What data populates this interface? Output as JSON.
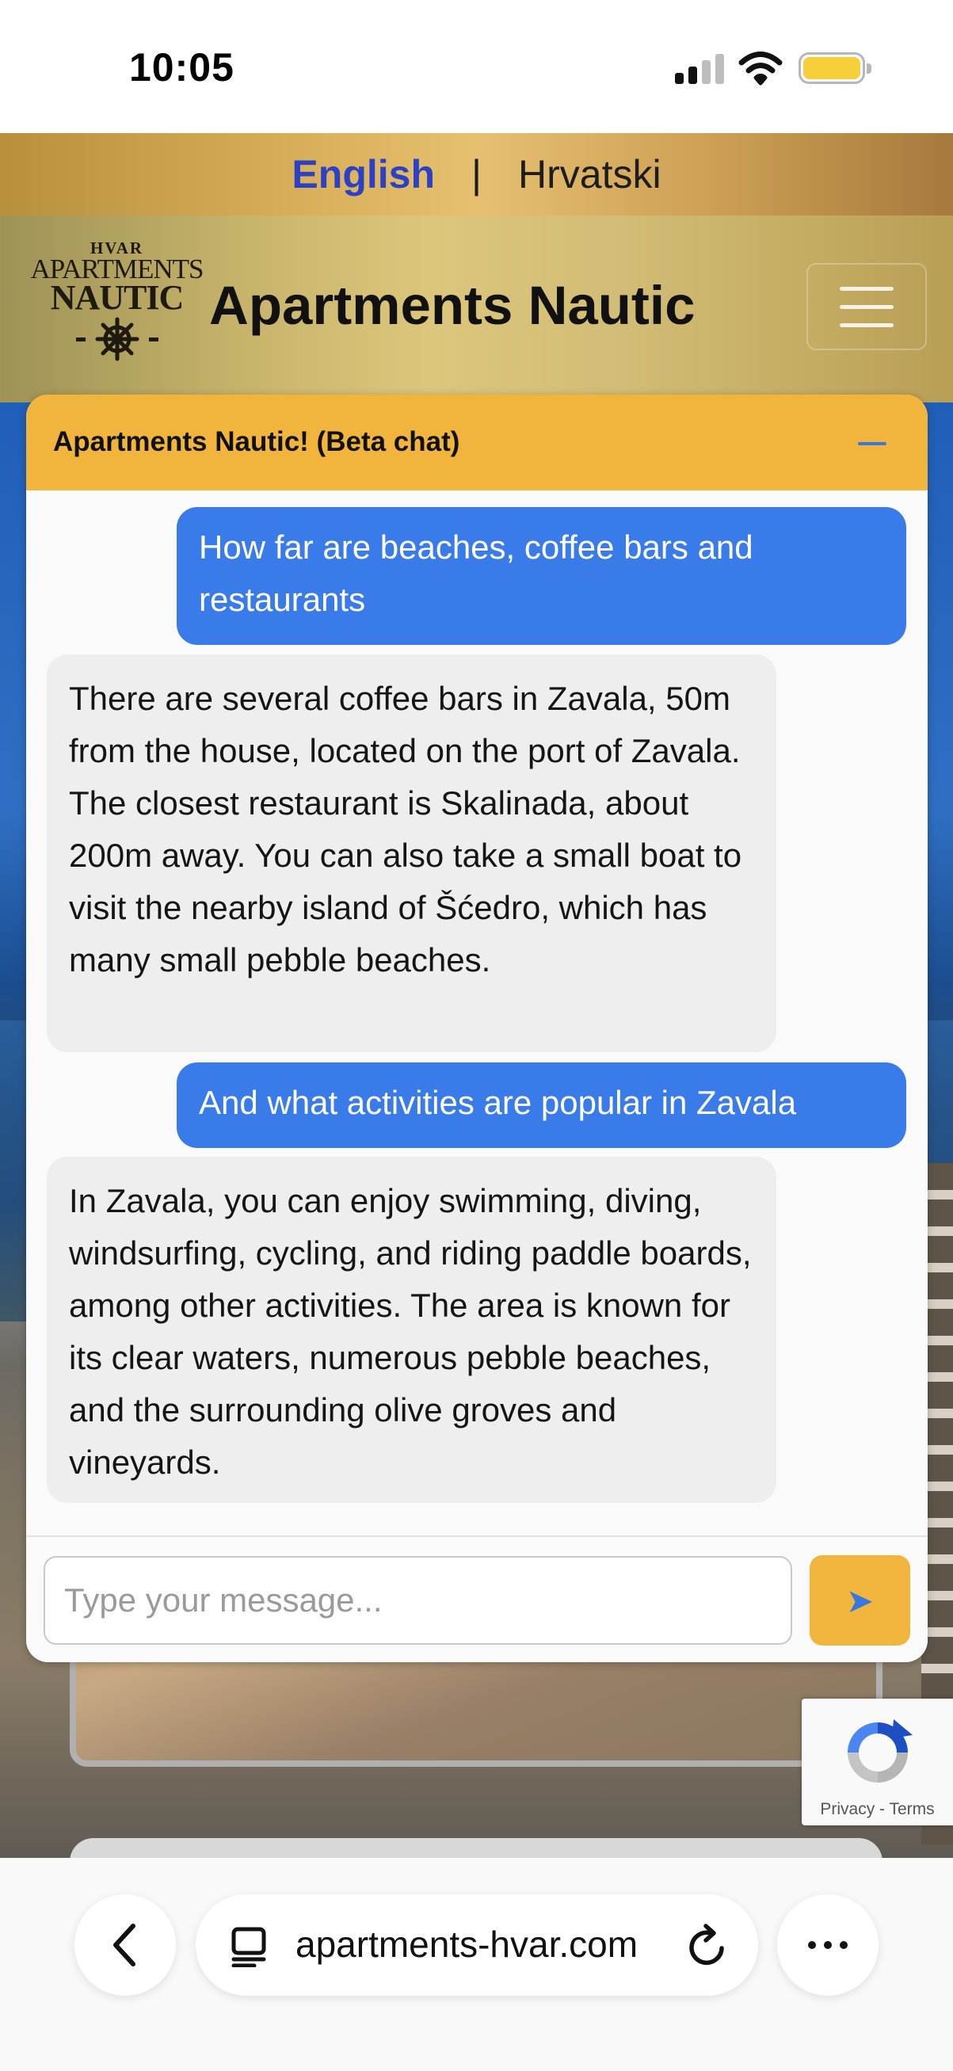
{
  "status_bar": {
    "time": "10:05"
  },
  "language_bar": {
    "english": "English",
    "separator": "|",
    "croatian": "Hrvatski"
  },
  "header": {
    "logo": {
      "line1": "HVAR",
      "line2": "APARTMENTS",
      "line3": "NAUTIC"
    },
    "title": "Apartments Nautic"
  },
  "chat": {
    "title": "Apartments Nautic! (Beta chat)",
    "messages": [
      {
        "role": "user",
        "text": "How far are beaches, coffee bars and restaurants"
      },
      {
        "role": "bot",
        "text": "There are several coffee bars in Zavala, 50m from the house, located on the port of Zavala. The closest restaurant is Skalinada, about 200m away. You can also take a small boat to visit the nearby island of Šćedro, which has many small pebble beaches."
      },
      {
        "role": "user",
        "text": "And what activities are popular in Zavala"
      },
      {
        "role": "bot",
        "text": "In Zavala, you can enjoy swimming, diving, windsurfing, cycling, and riding paddle boards, among other activities. The area is known for its clear waters, numerous pebble beaches, and the surrounding olive groves and vineyards."
      }
    ],
    "input_placeholder": "Type your message...",
    "send_icon": "➤"
  },
  "recaptcha": {
    "links": "Privacy - Terms"
  },
  "browser": {
    "url": "apartments-hvar.com"
  },
  "colors": {
    "user_bubble": "#3a7bea",
    "bot_bubble": "#eeeeee",
    "chat_header": "#f1b53d",
    "language_active": "#2d41c4"
  }
}
